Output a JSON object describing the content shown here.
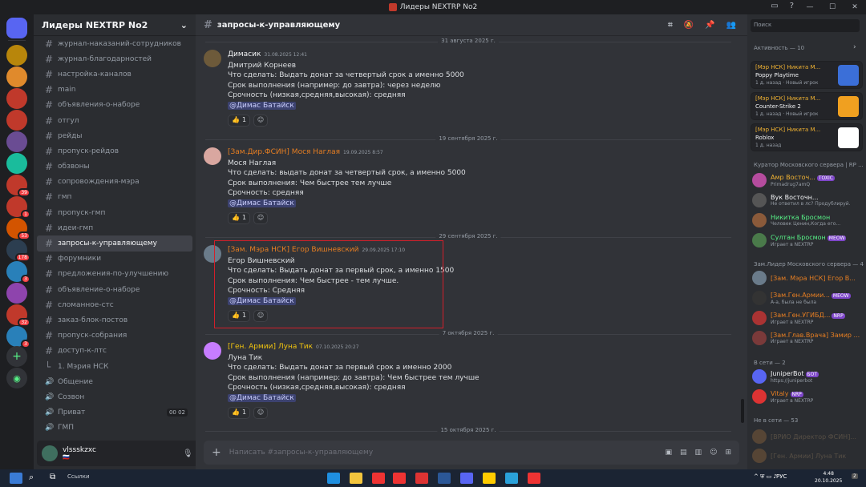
{
  "window": {
    "title": "Лидеры NEXTRP No2"
  },
  "server": {
    "name": "Лидеры NEXTRP No2"
  },
  "servers": [
    {
      "badge": ""
    },
    {
      "badge": ""
    },
    {
      "badge": ""
    },
    {
      "badge": ""
    },
    {
      "badge": ""
    },
    {
      "badge": ""
    },
    {
      "badge": "39"
    },
    {
      "badge": "1"
    },
    {
      "badge": "53"
    },
    {
      "badge": "178"
    },
    {
      "badge": "3"
    },
    {
      "badge": ""
    },
    {
      "badge": "32"
    },
    {
      "badge": "3"
    }
  ],
  "channels": [
    {
      "label": "журнал-наказаний-сотрудников"
    },
    {
      "label": "журнал-благодарностей"
    },
    {
      "label": "настройка-каналов"
    },
    {
      "label": "main"
    },
    {
      "label": "объявления-о-наборе"
    },
    {
      "label": "отгул"
    },
    {
      "label": "рейды"
    },
    {
      "label": "пропуск-рейдов"
    },
    {
      "label": "обзвоны"
    },
    {
      "label": "сопровождения-мэра"
    },
    {
      "label": "гмп"
    },
    {
      "label": "пропуск-гмп"
    },
    {
      "label": "идеи-гмп"
    },
    {
      "label": "запросы-к-управляющему"
    },
    {
      "label": "форумники"
    },
    {
      "label": "предложения-по-улучшению"
    },
    {
      "label": "объявление-о-наборе"
    },
    {
      "label": "сломанное-стс"
    },
    {
      "label": "заказ-блок-постов"
    },
    {
      "label": "пропуск-собрания"
    },
    {
      "label": "доступ-к-лтс"
    },
    {
      "label": "1. Мэрия НСК"
    },
    {
      "label": "Общение"
    },
    {
      "label": "Созвон"
    },
    {
      "label": "Приват",
      "count": "00 02"
    },
    {
      "label": "ГМП"
    }
  ],
  "user": {
    "name": "vlssskzxc",
    "status": "🇷🇺"
  },
  "channel": {
    "name": "запросы-к-управляющему",
    "placeholder": "Написать #запросы-к-управляющему"
  },
  "search": {
    "placeholder": "Поиск"
  },
  "dates": [
    "31 августа 2025 г.",
    "19 сентября 2025 г.",
    "29 сентября 2025 г.",
    "7 октября 2025 г.",
    "15 октября 2025 г."
  ],
  "messages": [
    {
      "author": "Димасик",
      "time": "31.08.2025 12:41",
      "color": "#f2f3f5",
      "lines": [
        "Дмитрий Корнеев",
        "Что сделать:  Выдать донат за четвертый срок а именно 5000",
        "Срок выполнения (например: до завтра): через неделю",
        "Срочность (низкая,средняя,высокая): средняя"
      ],
      "mention": "@Димас Батайск",
      "react_count": "1"
    },
    {
      "author": "[Зам.Дир.ФСИН] Мося Наглая",
      "time": "19.09.2025 8:57",
      "color": "#e67e22",
      "lines": [
        "Мося Наглая",
        "Что сделать: выдать донат за четвертый срок, а именно 5000",
        "Срок выполнения: Чем быстрее тем лучше",
        "Срочность: средняя"
      ],
      "mention": "@Димас Батайск",
      "react_count": "1"
    },
    {
      "author": "[Зам. Мэра НСК] Егор Вишневский",
      "time": "29.09.2025 17:10",
      "color": "#e67e22",
      "lines": [
        "Егор Вишневский",
        "Что сделать: Выдать донат за первый срок, а именно 1500",
        "Срок выполнения: Чем быстрее - тем лучше.",
        "Срочность: Средняя"
      ],
      "mention": "@Димас Батайск",
      "react_count": "1"
    },
    {
      "author": "[Ген. Армии] Луна Тик",
      "time": "07.10.2025 20:27",
      "color": "#f1c40f",
      "lines": [
        "Луна Тик",
        "Что сделать:  Выдать донат за первый срок а именно 2000",
        "Срок выполнения (например: до завтра): Чем быстрее тем лучше",
        "Срочность (низкая,средняя,высокая): средняя"
      ],
      "mention": "@Димас Батайск",
      "react_count": "1"
    }
  ],
  "members": {
    "activity_title": "Активность — 10",
    "activities": [
      {
        "name": "[Мэр НСК] Никита М...",
        "game": "Poppy Playtime",
        "sub": "1 д. назад · Новый игрок"
      },
      {
        "name": "[Мэр НСК] Никита М...",
        "game": "Counter-Strike 2",
        "sub": "1 д. назад · Новый игрок"
      },
      {
        "name": "[Мэр НСК] Никита М...",
        "game": "Roblox",
        "sub": "1 д. назад"
      }
    ],
    "group1": "Куратор Московского сервера | RP ...",
    "group1_members": [
      {
        "name": "Амр Восточ...",
        "sub": "Primadrug7amQ",
        "tag": "TOXIC",
        "color": "#f0b232"
      },
      {
        "name": "Вук Восточн...",
        "sub": "Не ответил в лс? Продублируй.",
        "tag": "",
        "color": "#f2f3f5"
      },
      {
        "name": "Никитка Бросмон",
        "sub": "Человек Ценин,Когда его...",
        "tag": "",
        "color": "#57f287"
      },
      {
        "name": "Султан Бросмон",
        "sub": "Играет в NEXTRP",
        "tag": "MEOW",
        "color": "#57f287"
      }
    ],
    "group2": "Зам.Лидер Московского сервера — 4",
    "group2_members": [
      {
        "name": "[Зам. Мэра НСК] Егор В...",
        "sub": "",
        "tag": "",
        "color": "#e67e22"
      },
      {
        "name": "[Зам.Ген.Армии...",
        "sub": "А-а, была не была",
        "tag": "MEOW",
        "color": "#e67e22"
      },
      {
        "name": "[Зам.Ген.УГИБД...",
        "sub": "Играет в NEXTRP",
        "tag": "NRP",
        "color": "#e67e22"
      },
      {
        "name": "[Зам.Глав.Врача] Замир ...",
        "sub": "Играет в NEXTRP",
        "tag": "",
        "color": "#e67e22"
      }
    ],
    "online_title": "В сети — 2",
    "online": [
      {
        "name": "JuniperBot",
        "sub": "https://juniperbot",
        "tag": "БОТ",
        "color": "#f2f3f5"
      },
      {
        "name": "Vitaly",
        "sub": "Играет в NEXTRP",
        "tag": "NRP",
        "color": "#e67e22"
      }
    ],
    "offline_title": "Не в сети — 53",
    "offline": [
      {
        "name": "[ВРИО Директор ФСИН]...",
        "color": "#7a6a55"
      },
      {
        "name": "[Ген. Армии] Луна Тик",
        "color": "#7a6a55"
      }
    ]
  },
  "taskbar": {
    "links": "Ссылки",
    "time": "4:48",
    "date": "20.10.2025",
    "lang": "РУС",
    "notif": "2"
  }
}
